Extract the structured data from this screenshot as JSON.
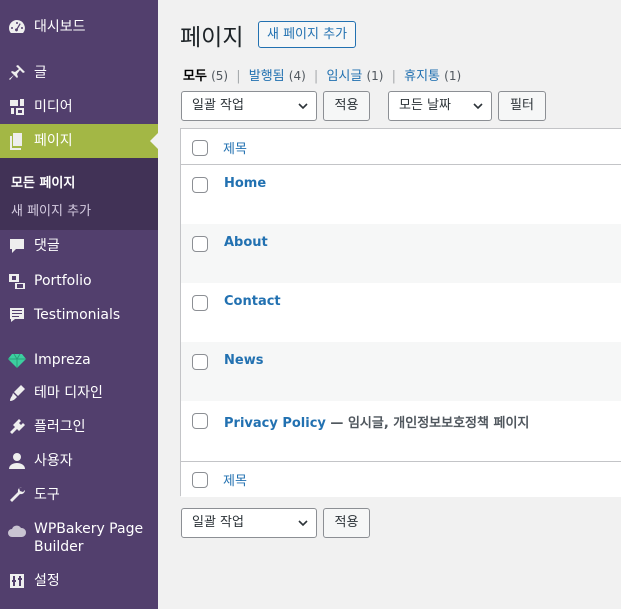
{
  "sidebar": {
    "items": [
      {
        "label": "대시보드",
        "icon": "dashboard-icon"
      },
      {
        "label": "글",
        "icon": "pin-icon"
      },
      {
        "label": "미디어",
        "icon": "media-icon"
      },
      {
        "label": "페이지",
        "icon": "pages-icon",
        "active": true
      },
      {
        "label": "댓글",
        "icon": "comment-icon"
      },
      {
        "label": "Portfolio",
        "icon": "portfolio-icon"
      },
      {
        "label": "Testimonials",
        "icon": "testimonials-icon"
      },
      {
        "label": "Impreza",
        "icon": "gem-icon"
      },
      {
        "label": "테마 디자인",
        "icon": "brush-icon"
      },
      {
        "label": "플러그인",
        "icon": "plugin-icon"
      },
      {
        "label": "사용자",
        "icon": "user-icon"
      },
      {
        "label": "도구",
        "icon": "wrench-icon"
      },
      {
        "label": "WPBakery Page Builder",
        "icon": "cloud-icon"
      },
      {
        "label": "설정",
        "icon": "settings-icon"
      }
    ],
    "submenu": [
      {
        "label": "모든 페이지",
        "current": true
      },
      {
        "label": "새 페이지 추가",
        "current": false
      }
    ]
  },
  "main": {
    "title": "페이지",
    "add_new": "새 페이지 추가",
    "filters": {
      "all": "모두",
      "all_count": "(5)",
      "published": "발행됨",
      "published_count": "(4)",
      "draft": "임시글",
      "draft_count": "(1)",
      "trash": "휴지통",
      "trash_count": "(1)",
      "separator": "|"
    },
    "bulk_action": "일괄 작업",
    "apply": "적용",
    "all_dates": "모든 날짜",
    "filter": "필터",
    "column_title": "제목",
    "rows": [
      {
        "title": "Home",
        "state": ""
      },
      {
        "title": "About",
        "state": ""
      },
      {
        "title": "Contact",
        "state": ""
      },
      {
        "title": "News",
        "state": ""
      },
      {
        "title": "Privacy Policy",
        "state": " — 임시글, 개인정보보호정책 페이지"
      }
    ]
  },
  "colors": {
    "sidebar_bg": "#523f6d",
    "submenu_bg": "#413256",
    "active_bg": "#a3b745",
    "link": "#2271b1"
  }
}
